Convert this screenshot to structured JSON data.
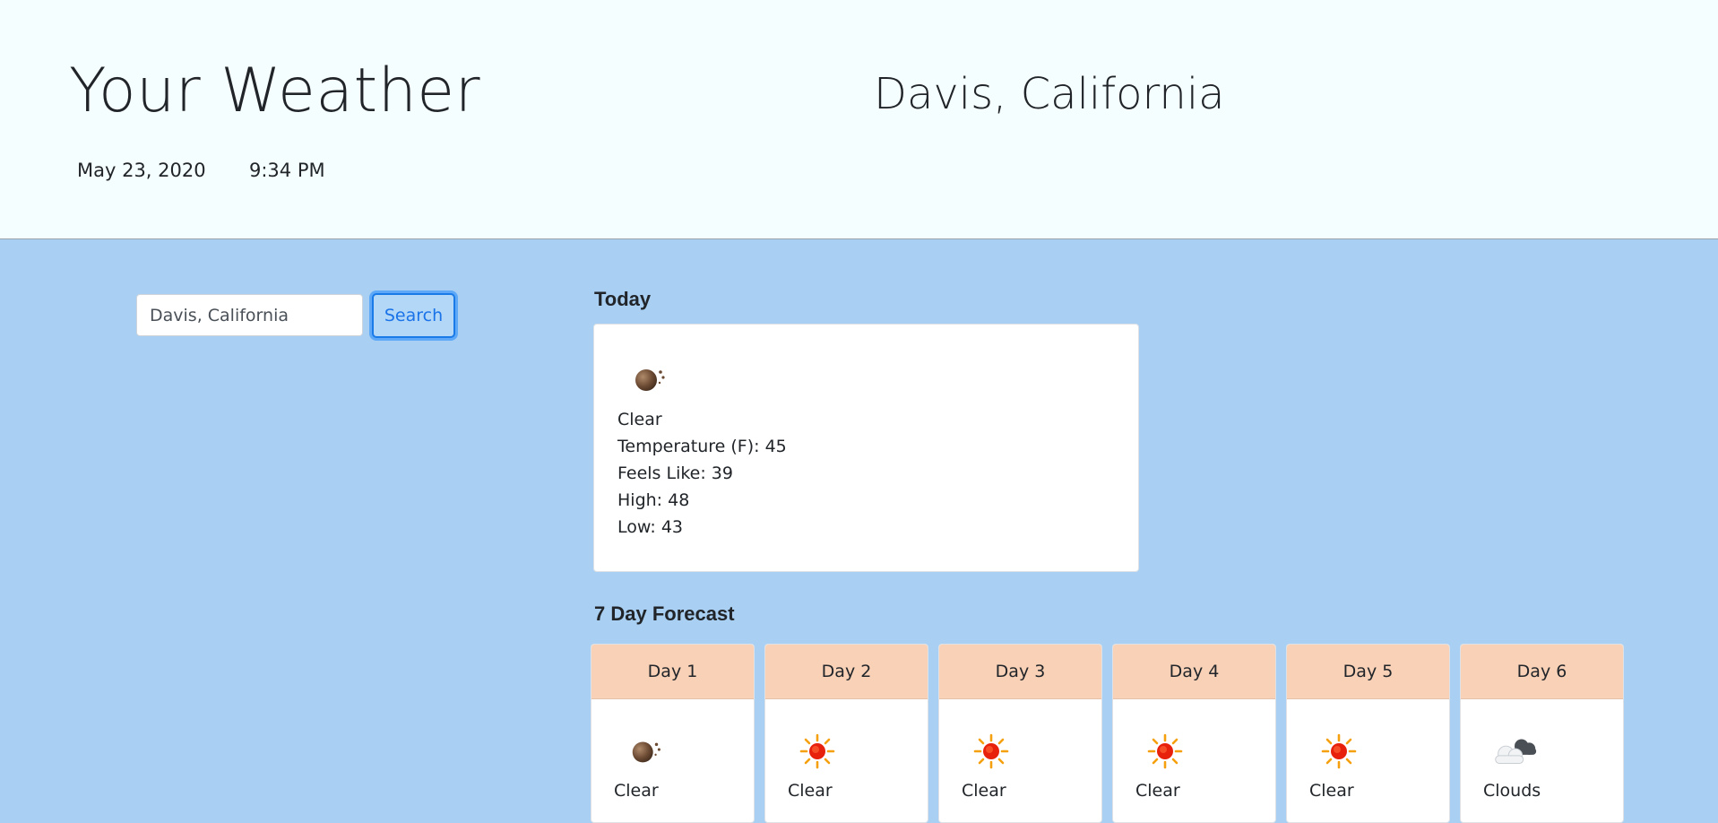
{
  "header": {
    "title": "Your Weather",
    "location": "Davis, California",
    "date": "May 23, 2020",
    "time": "9:34 PM"
  },
  "search": {
    "value": "Davis, California",
    "button_label": "Search"
  },
  "today": {
    "heading": "Today",
    "icon": "moon-icon",
    "condition": "Clear",
    "temperature": "Temperature (F): 45",
    "feels_like": "Feels Like: 39",
    "high": "High: 48",
    "low": "Low: 43"
  },
  "forecast": {
    "heading": "7 Day Forecast",
    "days": [
      {
        "label": "Day 1",
        "icon": "moon-icon",
        "condition": "Clear"
      },
      {
        "label": "Day 2",
        "icon": "sun-icon",
        "condition": "Clear"
      },
      {
        "label": "Day 3",
        "icon": "sun-icon",
        "condition": "Clear"
      },
      {
        "label": "Day 4",
        "icon": "sun-icon",
        "condition": "Clear"
      },
      {
        "label": "Day 5",
        "icon": "sun-icon",
        "condition": "Clear"
      },
      {
        "label": "Day 6",
        "icon": "clouds-icon",
        "condition": "Clouds"
      }
    ]
  },
  "colors": {
    "header_bg": "#f5feff",
    "page_bg": "#a9d0f3",
    "day_header_bg": "#f8d1b7",
    "accent": "#1a73e8"
  }
}
